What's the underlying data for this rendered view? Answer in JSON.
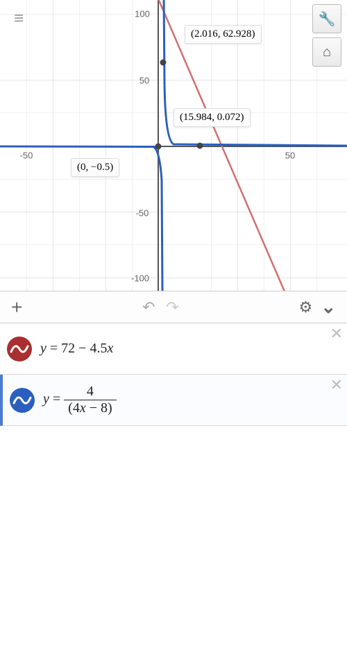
{
  "chart_data": {
    "type": "line",
    "xlim": [
      -70,
      62
    ],
    "ylim": [
      -110,
      110
    ],
    "x_ticks": [
      -50,
      50
    ],
    "y_ticks": [
      -100,
      -50,
      50,
      100
    ],
    "series": [
      {
        "name": "y = 72 - 4.5x",
        "color": "#d07070",
        "type": "linear",
        "slope": -4.5,
        "intercept": 72
      },
      {
        "name": "y = 4/(4x-8)",
        "color": "#2b5fbf",
        "type": "rational"
      }
    ],
    "labeled_points": [
      {
        "x": 2.016,
        "y": 62.928,
        "label": "(2.016, 62.928)"
      },
      {
        "x": 15.984,
        "y": 0.072,
        "label": "(15.984, 0.072)"
      },
      {
        "x": 0,
        "y": -0.5,
        "label": "(0, −0.5)"
      }
    ]
  },
  "axis_labels": {
    "n50": "-50",
    "p50": "50",
    "n100": "-100",
    "p100": "100"
  },
  "points": {
    "p1": "(2.016, 62.928)",
    "p2": "(15.984, 0.072)",
    "p3": "(0, −0.5)"
  },
  "toolbar": {
    "plus": "+",
    "undo": "↶",
    "redo": "↷",
    "gear": "⚙",
    "chevron": "⌄"
  },
  "exprs": {
    "e1_y": "y",
    "e1_eq": " = 72 − 4.5",
    "e1_x": "x",
    "e2_y": "y",
    "e2_eq": " = ",
    "e2_num": "4",
    "e2_den_l": "(4",
    "e2_den_x": "x",
    "e2_den_r": " − 8)",
    "close": "✕"
  },
  "icons": {
    "hamburger": "≡",
    "wrench": "🔧",
    "home": "⌂"
  }
}
